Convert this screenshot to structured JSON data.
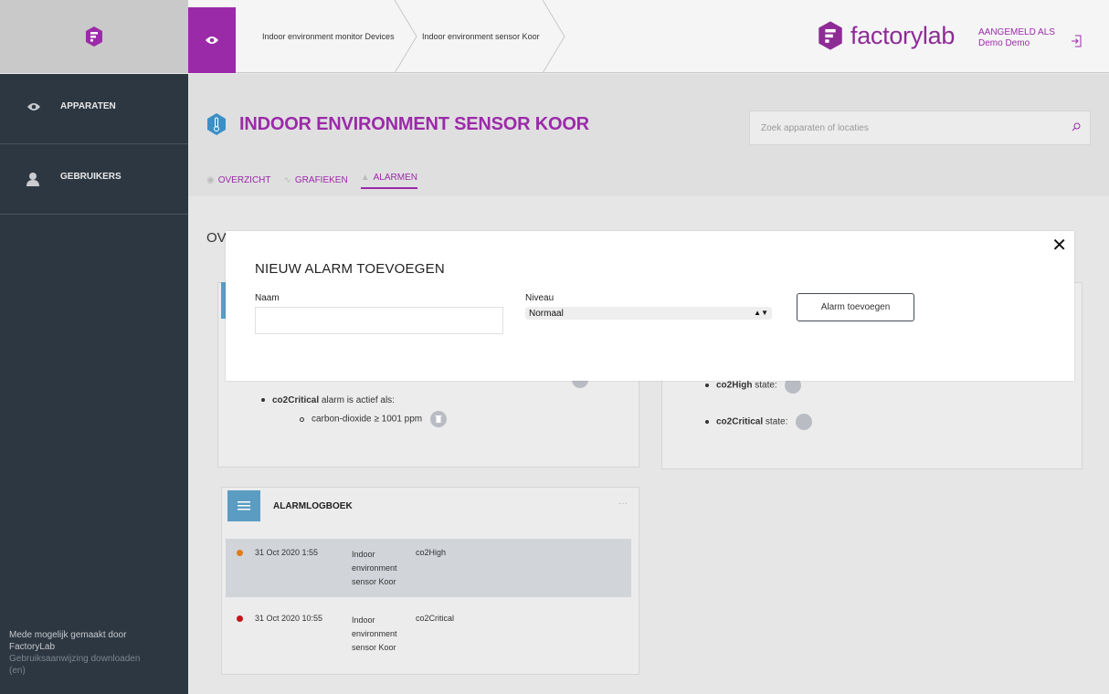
{
  "breadcrumbs": [
    "Indoor environment monitor Devices",
    "Indoor environment sensor Koor"
  ],
  "brand": {
    "name": "factorylab",
    "color": "#8e2c96"
  },
  "user": {
    "label": "AANGEMELD ALS",
    "name": "Demo Demo"
  },
  "sidebar": {
    "items": [
      {
        "label": "APPARATEN",
        "icon": "eye-icon"
      },
      {
        "label": "GEBRUIKERS",
        "icon": "user-icon"
      }
    ],
    "footer": {
      "powered_by": "Mede mogelijk gemaakt door FactoryLab",
      "manual_link": "Gebruiksaanwijzing downloaden (en)"
    }
  },
  "page": {
    "title": "INDOOR ENVIRONMENT SENSOR KOOR",
    "search_placeholder": "Zoek apparaten of locaties",
    "tabs": [
      {
        "label": "OVERZICHT",
        "active": false
      },
      {
        "label": "GRAFIEKEN",
        "active": false
      },
      {
        "label": "ALARMEN",
        "active": true
      }
    ],
    "section_heading_partial": "OV"
  },
  "alarm_rules": {
    "critical_name": "co2Critical",
    "critical_text": "alarm is actief als:",
    "critical_condition": "carbon-dioxide ≥ 1001 ppm"
  },
  "alarm_states": [
    {
      "name": "co2High",
      "suffix": "state:"
    },
    {
      "name": "co2Critical",
      "suffix": "state:"
    }
  ],
  "alarm_log": {
    "title": "ALARMLOGBOEK",
    "rows": [
      {
        "date": "31 Oct 2020 1:55",
        "device": "Indoor environment sensor Koor",
        "alarm": "co2High",
        "color": "#e07b1c"
      },
      {
        "date": "31 Oct 2020 10:55",
        "device": "Indoor environment sensor Koor",
        "alarm": "co2Critical",
        "color": "#c4161c"
      }
    ]
  },
  "modal": {
    "title": "NIEUW ALARM TOEVOEGEN",
    "name_label": "Naam",
    "name_value": "",
    "level_label": "Niveau",
    "level_value": "Normaal",
    "add_button": "Alarm toevoegen",
    "close": "✕"
  },
  "colors": {
    "accent": "#9b2aa8",
    "sidebar": "#2d3742",
    "sensor_blue": "#5b9cc2"
  }
}
